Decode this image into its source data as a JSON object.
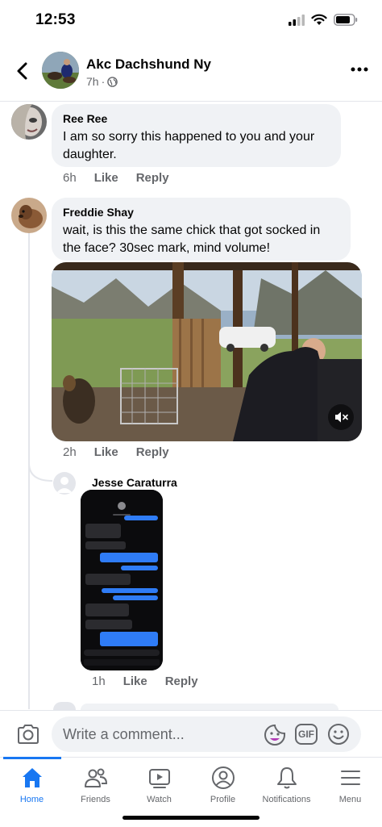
{
  "status_bar": {
    "time": "12:53"
  },
  "header": {
    "title": "Akc Dachshund Ny",
    "meta_time": "7h",
    "meta_separator": "·"
  },
  "comments": [
    {
      "author": "Ree Ree",
      "text": "I am so sorry this happened to you and your daughter.",
      "time": "6h",
      "like": "Like",
      "reply": "Reply"
    },
    {
      "author": "Freddie Shay",
      "text": "wait, is this the same chick that got socked in the face? 30sec mark, mind volume!",
      "time": "2h",
      "like": "Like",
      "reply": "Reply"
    }
  ],
  "reply": {
    "author": "Jesse Caraturra",
    "time": "1h",
    "like": "Like",
    "reply": "Reply"
  },
  "composer": {
    "placeholder": "Write a comment...",
    "gif_label": "GIF"
  },
  "tabs": [
    {
      "label": "Home",
      "icon": "home-icon",
      "active": true
    },
    {
      "label": "Friends",
      "icon": "friends-icon"
    },
    {
      "label": "Watch",
      "icon": "watch-icon"
    },
    {
      "label": "Profile",
      "icon": "profile-icon"
    },
    {
      "label": "Notifications",
      "icon": "bell-icon"
    },
    {
      "label": "Menu",
      "icon": "menu-icon"
    }
  ],
  "colors": {
    "accent": "#1877f2",
    "bubble": "#f0f2f5",
    "secondary_text": "#65676b"
  }
}
